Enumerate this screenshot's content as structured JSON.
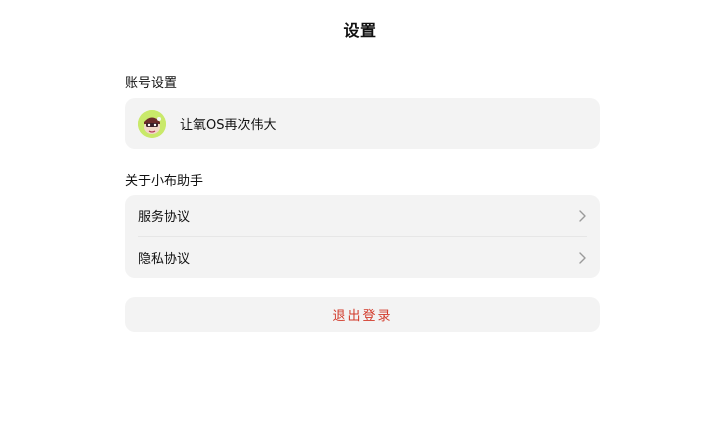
{
  "header": {
    "title": "设置"
  },
  "account_section": {
    "label": "账号设置",
    "username": "让氧OS再次伟大",
    "avatar_icon": "cartoon-avatar-icon",
    "avatar_bg": "#c9e96a"
  },
  "about_section": {
    "label": "关于小布助手",
    "items": [
      {
        "label": "服务协议",
        "icon": "chevron-right-icon"
      },
      {
        "label": "隐私协议",
        "icon": "chevron-right-icon"
      }
    ]
  },
  "logout": {
    "label": "退出登录",
    "color": "#d23a2a"
  },
  "colors": {
    "card_bg": "#f3f3f3",
    "page_bg": "#ffffff"
  }
}
